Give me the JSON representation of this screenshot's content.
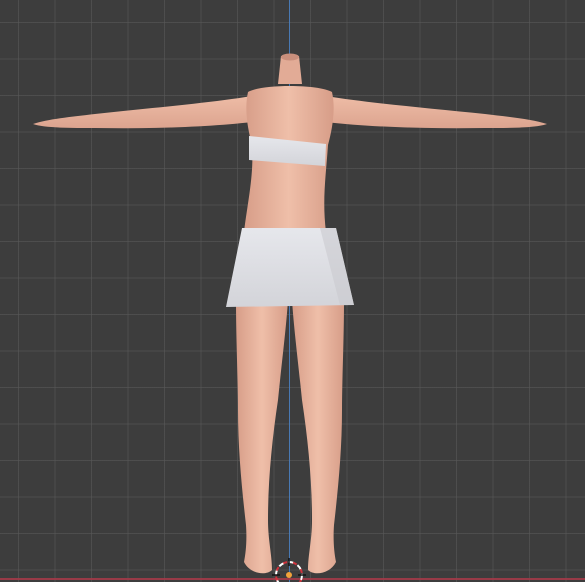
{
  "viewport": {
    "view": "front-orthographic",
    "background_color": "#3d3d3d",
    "grid_color": "#5a5a5a",
    "z_axis_color": "#4a7fc0",
    "x_axis_color": "#a33a48"
  },
  "model": {
    "pose": "T-pose",
    "skin_color": "#e8b59f",
    "clothing_color": "#dcdde2",
    "clothing_items": [
      "top-band",
      "skirt"
    ]
  },
  "icons": {
    "cursor": "3d-cursor-icon",
    "origin": "origin-point-icon"
  }
}
